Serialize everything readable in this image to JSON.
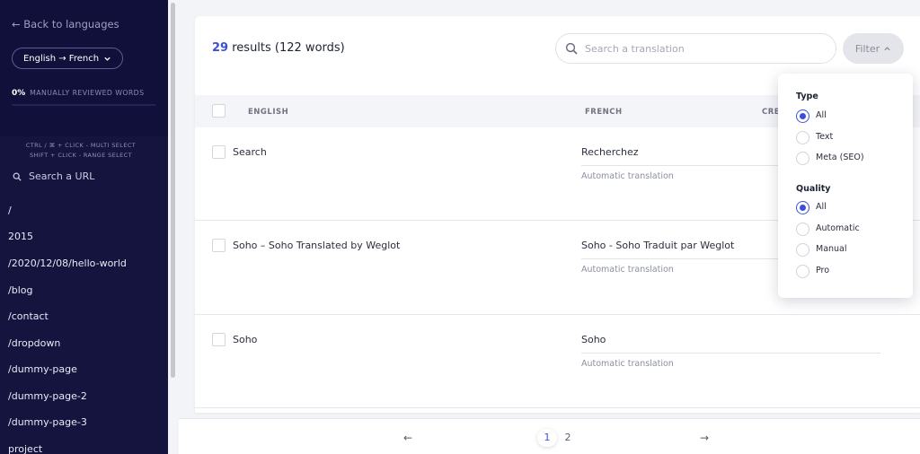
{
  "sidebar": {
    "back_label": "← Back to languages",
    "language_pair": "English → French",
    "reviewed_percent": "0%",
    "reviewed_label": "MANUALLY REVIEWED WORDS",
    "hint_multi": "CTRL / ⌘ + CLICK - MULTI SELECT",
    "hint_range": "SHIFT + CLICK - RANGE SELECT",
    "url_search_placeholder": "Search a URL",
    "urls": [
      "/",
      "2015",
      "/2020/12/08/hello-world",
      "/blog",
      "/contact",
      "/dropdown",
      "/dummy-page",
      "/dummy-page-2",
      "/dummy-page-3",
      "project"
    ]
  },
  "header": {
    "results_count": "29",
    "results_label": "results (122 words)",
    "search_placeholder": "Search a translation",
    "filter_label": "Filter"
  },
  "table": {
    "columns": [
      "ENGLISH",
      "FRENCH",
      "CRE"
    ],
    "rows": [
      {
        "source": "Search",
        "target": "Recherchez",
        "note": "Automatic translation"
      },
      {
        "source": "Soho – Soho Translated by Weglot",
        "target": "Soho - Soho Traduit par Weglot",
        "note": "Automatic translation"
      },
      {
        "source": "Soho",
        "target": "Soho",
        "note": "Automatic translation"
      }
    ]
  },
  "pagination": {
    "prev": "←",
    "pages": [
      "1",
      "2"
    ],
    "current": "1",
    "next": "→"
  },
  "filter": {
    "type_title": "Type",
    "type_options": [
      "All",
      "Text",
      "Meta (SEO)"
    ],
    "type_selected": "All",
    "quality_title": "Quality",
    "quality_options": [
      "All",
      "Automatic",
      "Manual",
      "Pro"
    ],
    "quality_selected": "All"
  },
  "colors": {
    "sidebar_bg": "#14143f",
    "accent": "#3d4fd8"
  }
}
